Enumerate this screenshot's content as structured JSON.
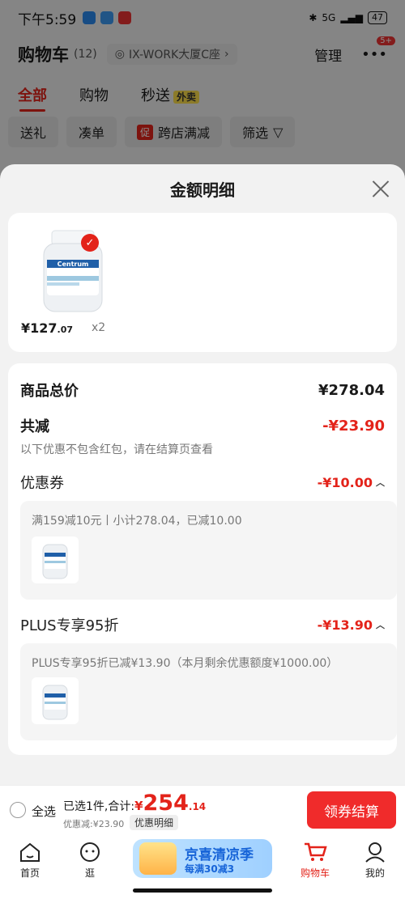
{
  "status_bar": {
    "time": "下午5:59",
    "battery": "47",
    "network": "5G"
  },
  "cart_header": {
    "title": "购物车",
    "count": "(12)",
    "address": "IX-WORK大厦C座",
    "manage": "管理",
    "more_badge": "5+"
  },
  "tabs": [
    {
      "label": "全部"
    },
    {
      "label": "购物"
    },
    {
      "label": "秒送"
    }
  ],
  "tab_tag": "外卖",
  "filters": {
    "gift": "送礼",
    "combine": "凑单",
    "promo_badge": "促",
    "cross_store": "跨店满减",
    "filter": "筛选"
  },
  "sheet": {
    "title": "金额明细",
    "product": {
      "price_int": "¥127",
      "price_dec": ".07",
      "qty": "x2",
      "brand": "Centrum"
    },
    "total_label": "商品总价",
    "total_value": "¥278.04",
    "reduce_label": "共减",
    "reduce_value": "-¥23.90",
    "note": "以下优惠不包含红包，请在结算页查看",
    "coupon": {
      "label": "优惠券",
      "value": "-¥10.00",
      "detail": "满159减10元丨小计278.04，已减10.00"
    },
    "plus": {
      "label": "PLUS专享95折",
      "value": "-¥13.90",
      "detail": "PLUS专享95折已减¥13.90（本月剩余优惠额度¥1000.00）"
    }
  },
  "checkout": {
    "select_all": "全选",
    "selected": "已选1件,合计:",
    "yen": "¥",
    "total_int": "254",
    "total_dec": ".14",
    "discount": "优惠减:¥23.90",
    "detail_chip": "优惠明细",
    "pay_button": "领券结算"
  },
  "tabbar": {
    "home": "首页",
    "browse": "逛",
    "banner_title": "京喜清凉季",
    "banner_sub": "每满30减3",
    "cart": "购物车",
    "mine": "我的"
  },
  "colors": {
    "accent": "#e3231a",
    "pay_button": "#f02b2b",
    "banner": "#9fd0ff"
  }
}
